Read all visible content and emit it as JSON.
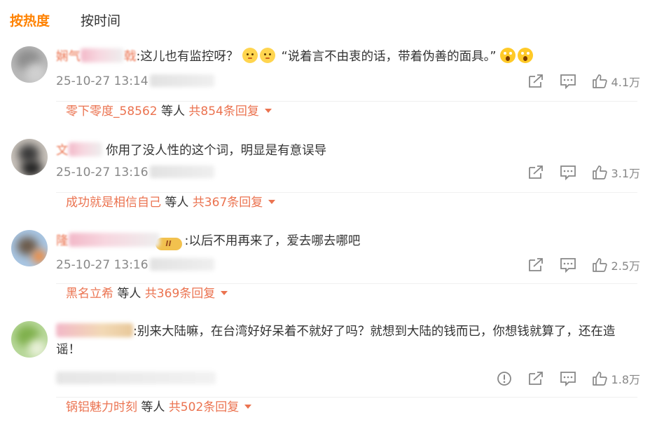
{
  "tabs": [
    {
      "label": "按热度",
      "active": true
    },
    {
      "label": "按时间",
      "active": false
    }
  ],
  "comments": [
    {
      "user_prefix": "娴气",
      "user_suffix": "戟",
      "text_main": ":这儿也有监控呀？",
      "text_quote": "“说着言不由衷的话，带着伪善的面具。”",
      "time": "25-10-27 13:14",
      "likes": "4.1万",
      "reply_user": "零下零度_58562",
      "reply_etc": " 等人 ",
      "reply_total": "共854条回复"
    },
    {
      "user_prefix": "文",
      "text": "你用了没人性的这个词，明显是有意误导",
      "time": "25-10-27 13:16",
      "likes": "3.1万",
      "reply_user": "成功就是相信自己",
      "reply_etc": " 等人 ",
      "reply_total": "共367条回复"
    },
    {
      "user_prefix": "隆",
      "badge": "II",
      "text": ":以后不用再来了，爱去哪去哪吧",
      "time": "25-10-27 13:16",
      "likes": "2.5万",
      "reply_user": "黑名立希",
      "reply_etc": " 等人 ",
      "reply_total": "共369条回复"
    },
    {
      "user_prefix": "",
      "text": ":别来大陆嘛，在台湾好好呆着不就好了吗？就想到大陆的钱而已，你想钱就算了，还在造谣！",
      "likes": "1.8万",
      "reply_user": "锅铝魅力时刻",
      "reply_etc": " 等人 ",
      "reply_total": "共502条回复"
    }
  ],
  "icons": [
    "share-icon",
    "comment-icon",
    "like-icon",
    "report-icon",
    "reply-caret-icon"
  ],
  "colors": {
    "accent": "#ff8200",
    "reply_link": "#eb7350",
    "muted": "#888888"
  }
}
